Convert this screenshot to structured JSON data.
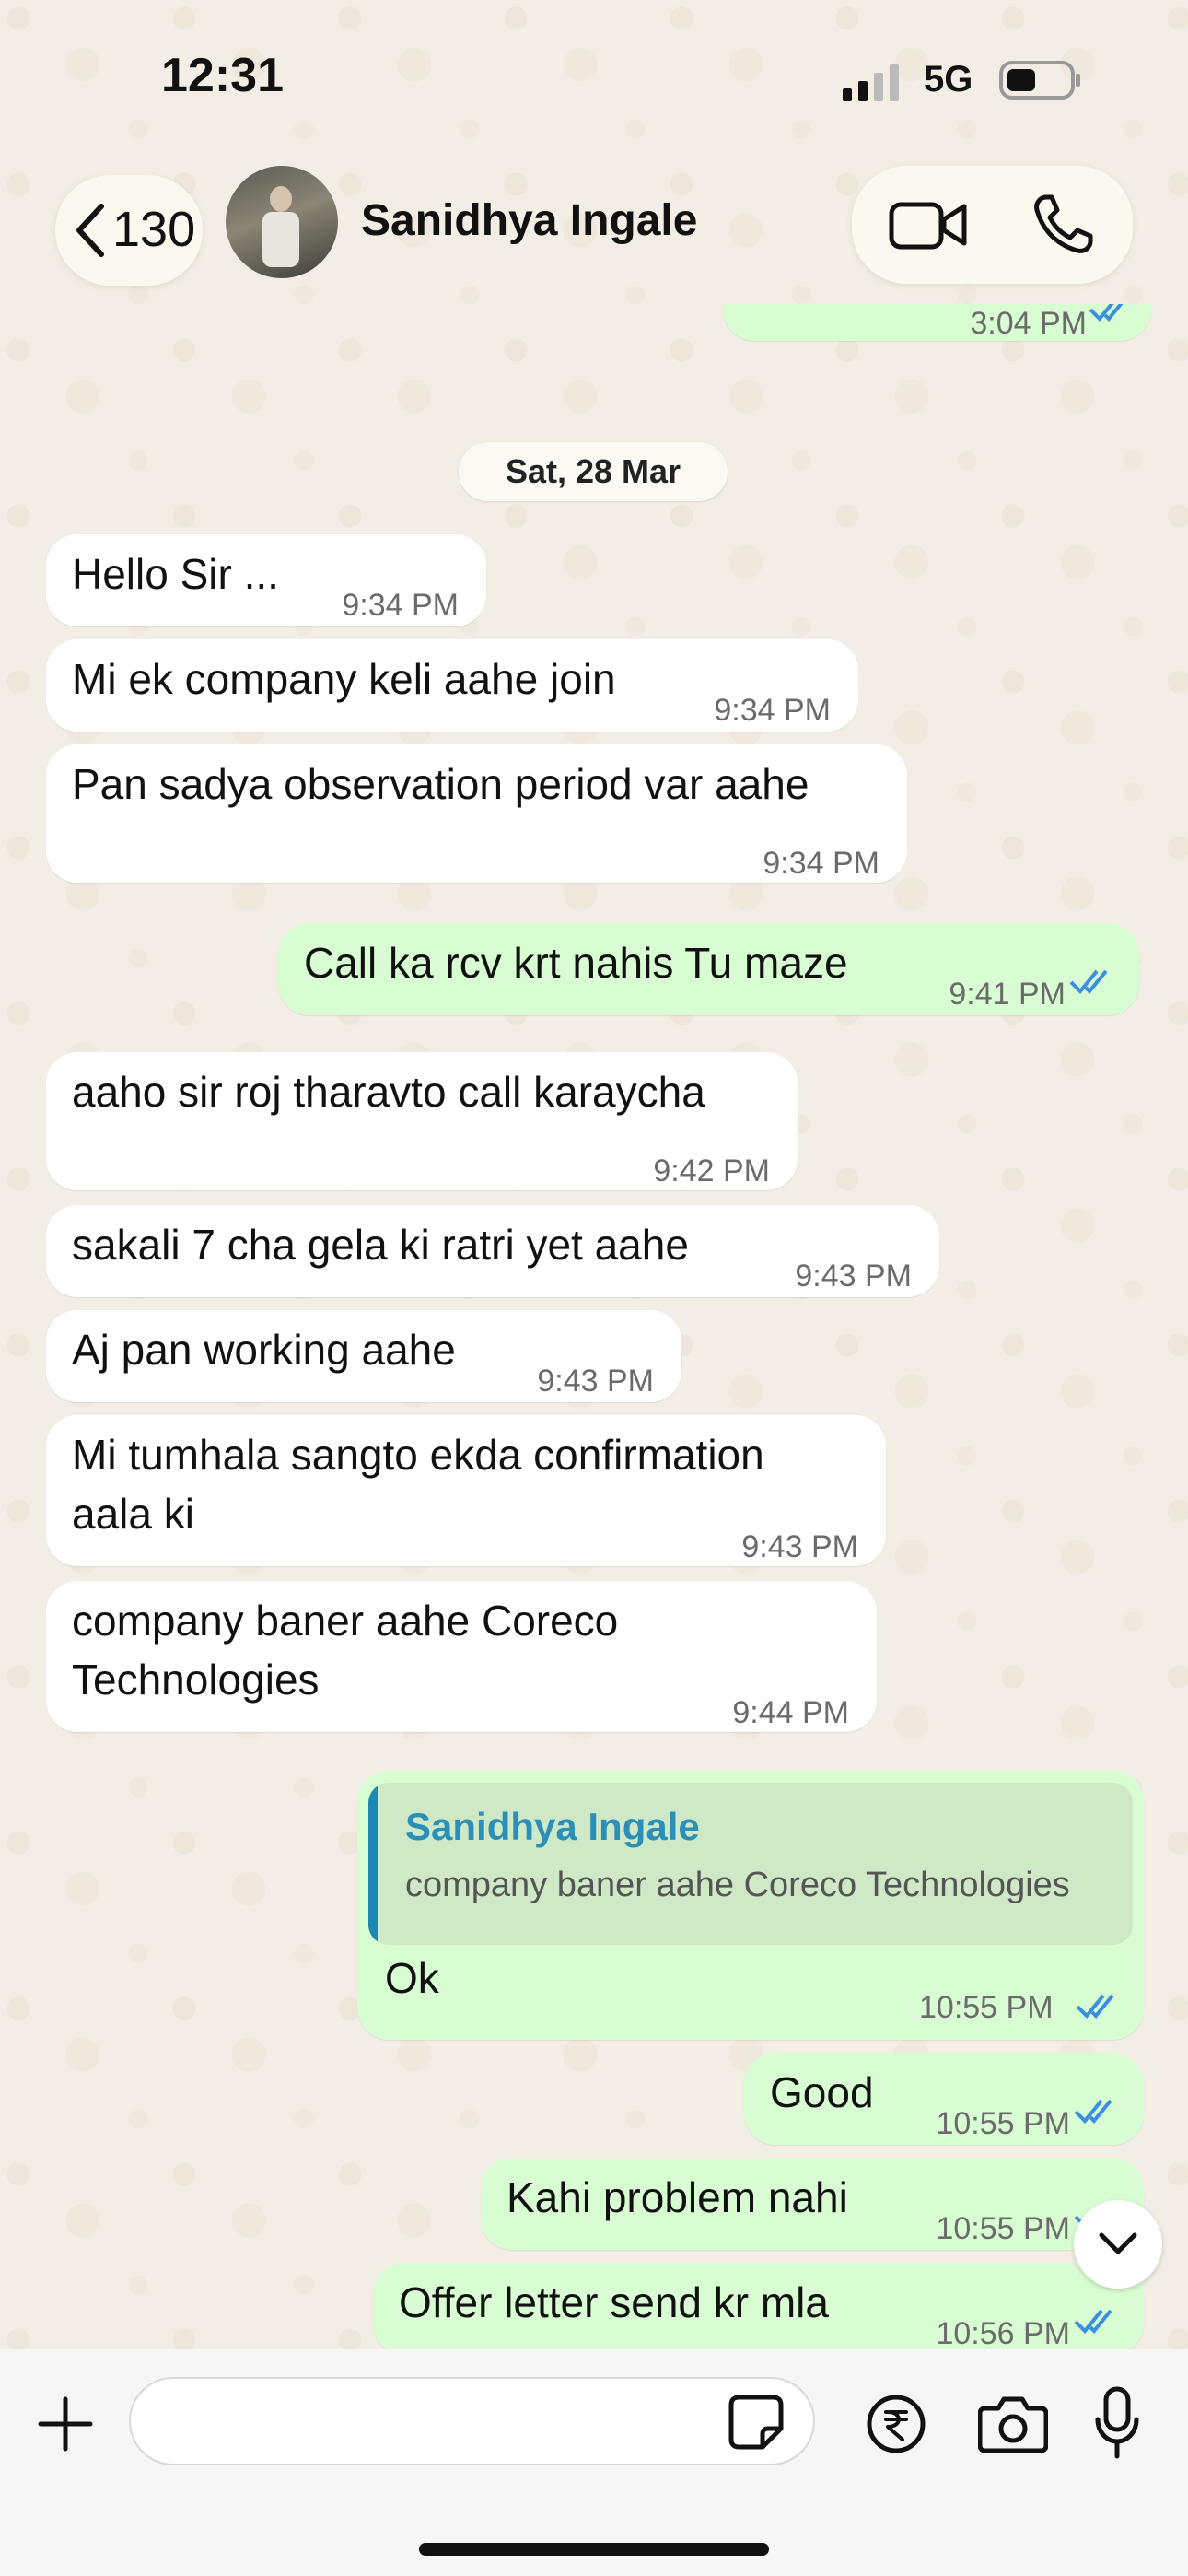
{
  "status_bar": {
    "time": "12:31",
    "network": "5G"
  },
  "header": {
    "back_count": "130",
    "contact_name": "Sanidhya Ingale"
  },
  "chat": {
    "date_label": "Sat, 28 Mar",
    "messages": [
      {
        "dir": "in",
        "text": "Hello Sir ...",
        "time": "9:34 PM"
      },
      {
        "dir": "in",
        "text": "Mi ek company keli aahe join",
        "time": "9:34 PM"
      },
      {
        "dir": "in",
        "text": "Pan sadya observation period var aahe",
        "time": "9:34 PM"
      },
      {
        "dir": "out",
        "text": "Call ka rcv krt nahis Tu maze",
        "time": "9:41 PM",
        "status": "read"
      },
      {
        "dir": "in",
        "text": "aaho sir roj tharavto call karaycha",
        "time": "9:42 PM"
      },
      {
        "dir": "in",
        "text": "sakali 7 cha gela ki ratri yet aahe",
        "time": "9:43 PM"
      },
      {
        "dir": "in",
        "text": "Aj pan working aahe",
        "time": "9:43 PM"
      },
      {
        "dir": "in",
        "text_line1": "Mi tumhala sangto ekda confirmation",
        "text_line2": "aala ki",
        "time": "9:43 PM"
      },
      {
        "dir": "in",
        "text_line1": "company baner aahe Coreco",
        "text_line2": "Technologies",
        "time": "9:44 PM"
      },
      {
        "dir": "out",
        "reply_to": {
          "name": "Sanidhya Ingale",
          "text": "company baner aahe Coreco Technologies"
        },
        "text": "Ok",
        "time": "10:55 PM",
        "status": "read"
      },
      {
        "dir": "out",
        "text": "Good",
        "time": "10:55 PM",
        "status": "read"
      },
      {
        "dir": "out",
        "text": "Kahi problem nahi",
        "time": "10:55 PM",
        "status": "read"
      },
      {
        "dir": "out",
        "text": "Offer letter send kr mla",
        "time": "10:56 PM",
        "status": "read"
      }
    ],
    "prev_message_time": "3:04 PM"
  },
  "input": {
    "value": "",
    "placeholder": ""
  },
  "colors": {
    "outgoing_bubble": "#d9fdd3",
    "incoming_bubble": "#ffffff",
    "read_tick": "#3b8fe0",
    "quote_bar": "#1e88b4"
  },
  "icons": [
    "back-chevron-icon",
    "video-call-icon",
    "phone-icon",
    "plus-icon",
    "sticker-icon",
    "rupee-icon",
    "camera-icon",
    "mic-icon",
    "chevron-down-icon",
    "double-tick-icon"
  ]
}
